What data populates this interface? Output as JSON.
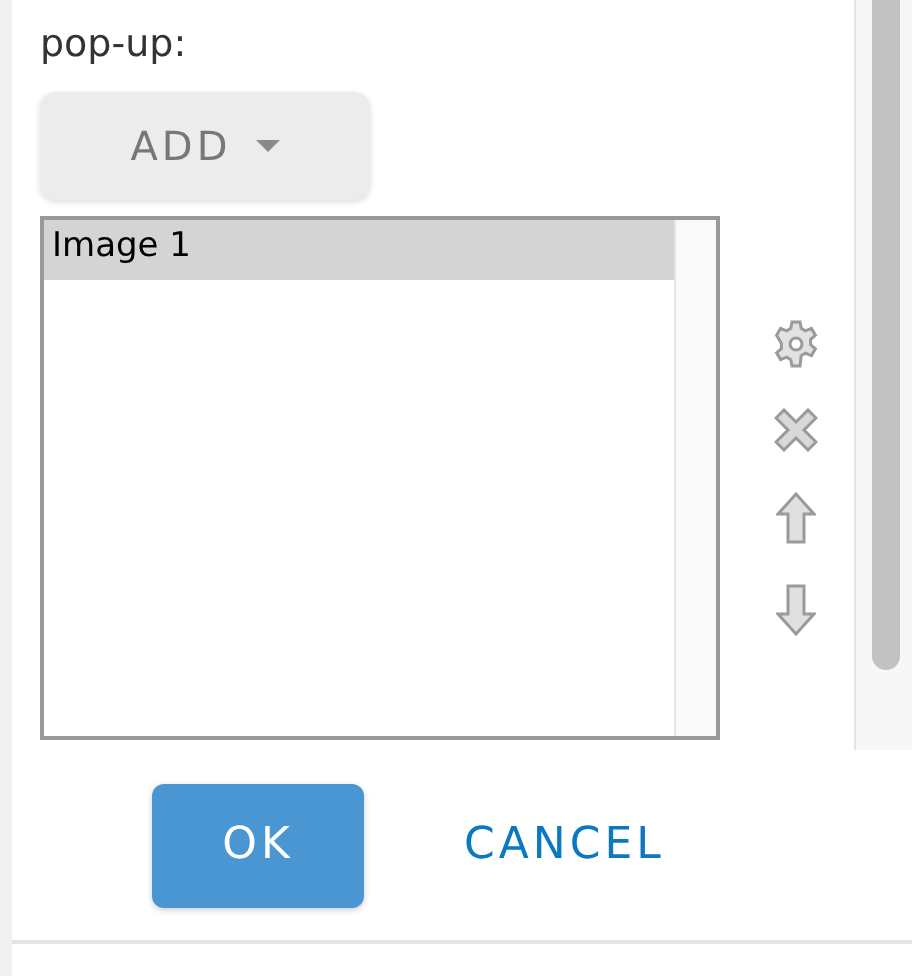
{
  "prompt": "pop-up:",
  "add_button": {
    "label": "ADD"
  },
  "list": {
    "items": [
      {
        "label": "Image 1",
        "selected": true
      }
    ]
  },
  "buttons": [
    {
      "label": "OK",
      "kind": "primary"
    },
    {
      "label": "CANCEL",
      "kind": "link"
    }
  ]
}
